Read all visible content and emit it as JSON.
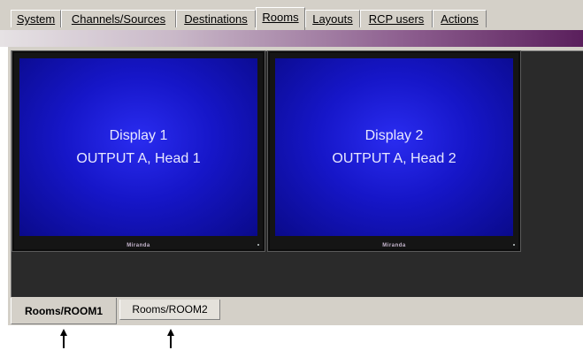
{
  "top_tabs": [
    {
      "label": "System"
    },
    {
      "label": "Channels/Sources"
    },
    {
      "label": "Destinations"
    },
    {
      "label": "Rooms",
      "active": true
    },
    {
      "label": "Layouts"
    },
    {
      "label": "RCP users"
    },
    {
      "label": "Actions"
    }
  ],
  "displays": [
    {
      "name": "Display 1",
      "output": "OUTPUT A, Head 1",
      "brand": "Miranda"
    },
    {
      "name": "Display 2",
      "output": "OUTPUT A, Head 2",
      "brand": "Miranda"
    }
  ],
  "room_tabs": [
    {
      "label": "Rooms/ROOM1",
      "active": true
    },
    {
      "label": "Rooms/ROOM2",
      "active": false
    }
  ],
  "colors": {
    "screen_blue": "#1616c8",
    "panel_gray": "#d4d0c8",
    "stage_dark": "#2a2a2a",
    "strip_purple": "#5a1f5c"
  },
  "icons": {
    "pointer_arrow": "up-arrow-icon"
  }
}
